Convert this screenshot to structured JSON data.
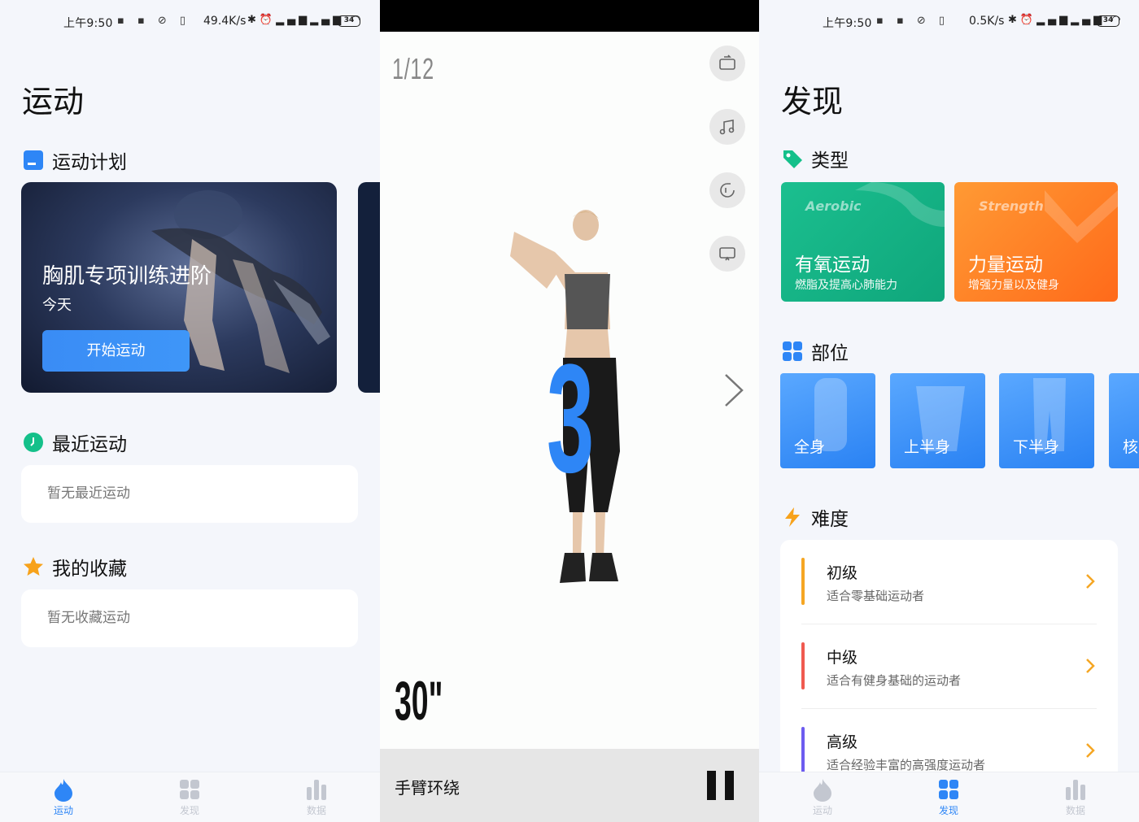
{
  "status_left": {
    "time": "上午9:50",
    "speed": "49.4K/s",
    "battery": "34"
  },
  "status_right": {
    "time": "上午9:50",
    "speed": "0.5K/s",
    "battery": "34"
  },
  "sport": {
    "title": "运动",
    "plan_section": "运动计划",
    "plan_card": {
      "title": "胸肌专项训练进阶",
      "subtitle": "今天",
      "start_label": "开始运动"
    },
    "recent_section": "最近运动",
    "recent_empty": "暂无最近运动",
    "favorites_section": "我的收藏",
    "favorites_empty": "暂无收藏运动"
  },
  "workout": {
    "progress": "1/12",
    "countdown": "3",
    "timer": "30\"",
    "exercise_name": "手臂环绕",
    "icons": [
      "rotate-screen-icon",
      "music-icon",
      "timer-reset-icon",
      "cast-screen-icon"
    ]
  },
  "discover": {
    "title": "发现",
    "type_section": "类型",
    "types": [
      {
        "en": "Aerobic",
        "name": "有氧运动",
        "desc": "燃脂及提高心肺能力",
        "color_from": "#1bbf8f",
        "color_to": "#0fa67b"
      },
      {
        "en": "Strength",
        "name": "力量运动",
        "desc": "增强力量以及健身",
        "color_from": "#ff9a34",
        "color_to": "#ff6a1a"
      }
    ],
    "part_section": "部位",
    "parts": [
      "全身",
      "上半身",
      "下半身",
      "核"
    ],
    "difficulty_section": "难度",
    "difficulties": [
      {
        "name": "初级",
        "desc": "适合零基础运动者",
        "color": "#f5a623"
      },
      {
        "name": "中级",
        "desc": "适合有健身基础的运动者",
        "color": "#f05a4f"
      },
      {
        "name": "高级",
        "desc": "适合经验丰富的高强度运动者",
        "color": "#6d5cf0"
      }
    ]
  },
  "tabbar": {
    "sport": "运动",
    "discover": "发现",
    "data": "数据"
  },
  "colors": {
    "accent": "#2e86f6",
    "inactive": "#c3c7d0"
  }
}
